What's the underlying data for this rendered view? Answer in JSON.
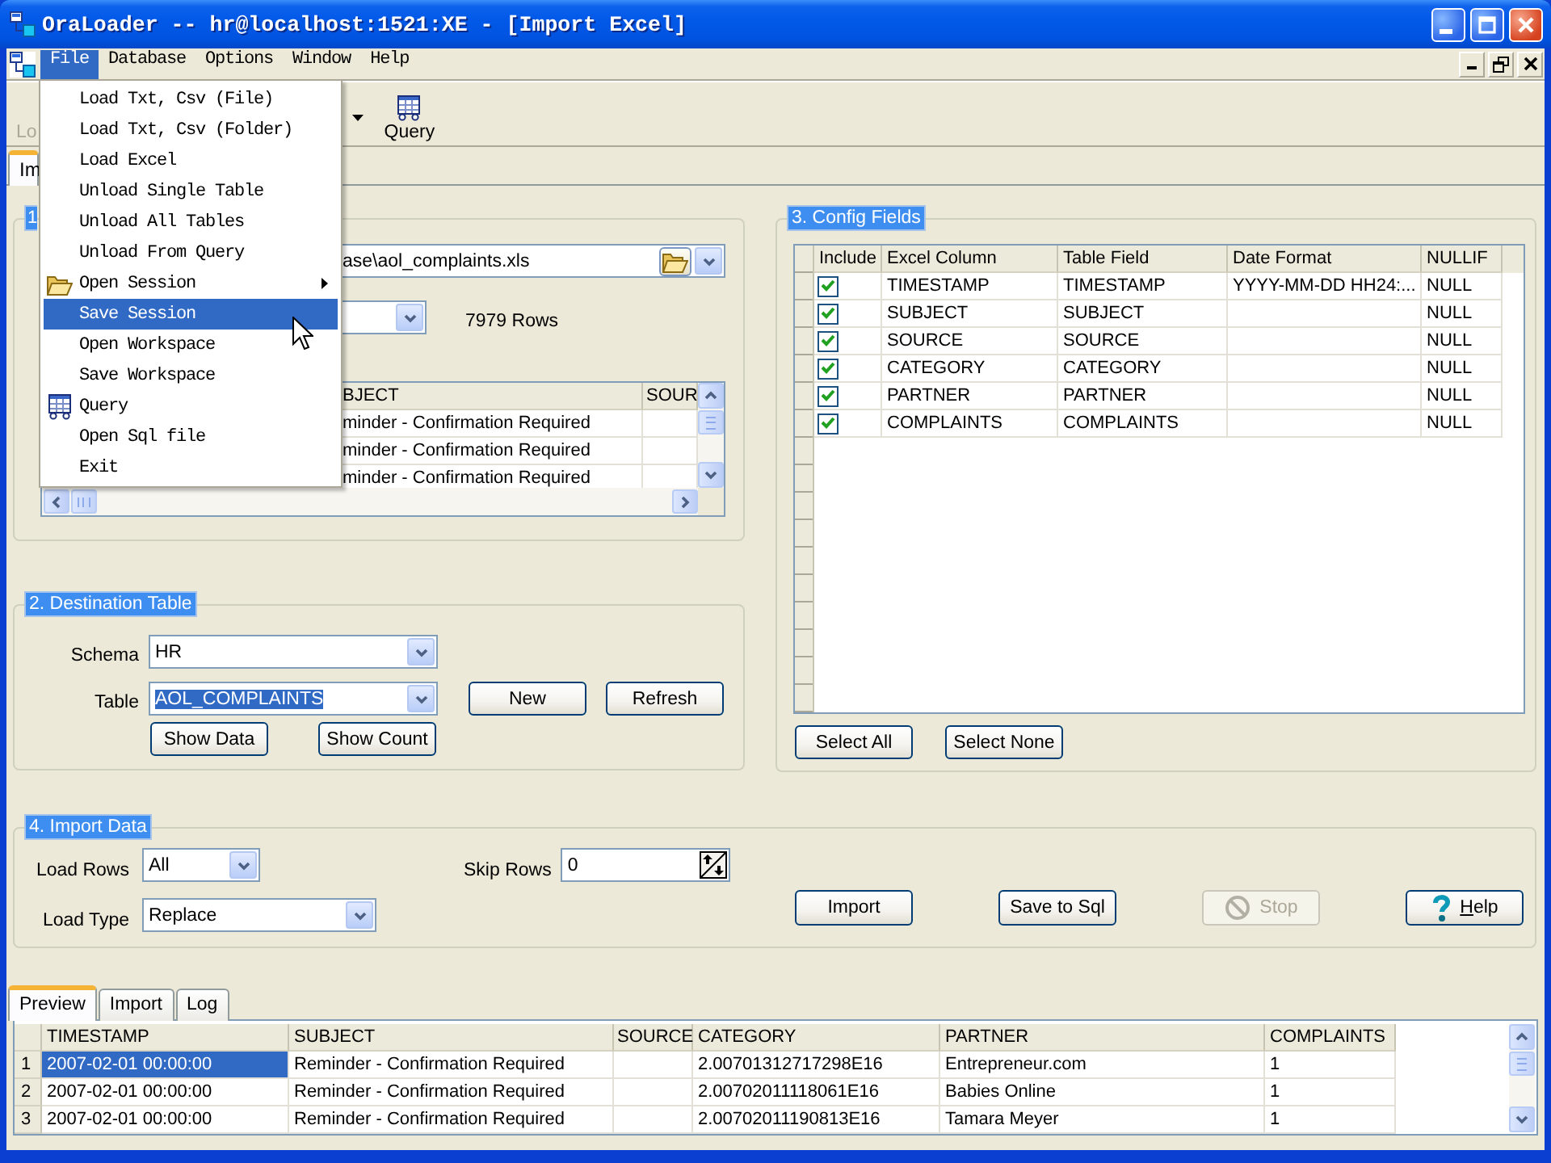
{
  "window": {
    "title": "OraLoader -- hr@localhost:1521:XE - [Import Excel]"
  },
  "menu_bar": {
    "items": [
      {
        "label": "File",
        "selected": true
      },
      {
        "label": "Database",
        "selected": false
      },
      {
        "label": "Options",
        "selected": false
      },
      {
        "label": "Window",
        "selected": false
      },
      {
        "label": "Help",
        "selected": false
      }
    ]
  },
  "file_menu": {
    "items": [
      {
        "label": "Load Txt, Csv (File)",
        "kind": "plain",
        "submenu": false,
        "selected": false
      },
      {
        "label": "Load Txt, Csv (Folder)",
        "kind": "plain",
        "submenu": false,
        "selected": false
      },
      {
        "label": "Load Excel",
        "kind": "plain",
        "submenu": false,
        "selected": false
      },
      {
        "label": "Unload Single Table",
        "kind": "plain",
        "submenu": false,
        "selected": false
      },
      {
        "label": "Unload All Tables",
        "kind": "plain",
        "submenu": false,
        "selected": false
      },
      {
        "label": "Unload From Query",
        "kind": "plain",
        "submenu": false,
        "selected": false
      },
      {
        "label": "Open Session",
        "kind": "folder",
        "submenu": true,
        "selected": false
      },
      {
        "label": "Save Session",
        "kind": "plain",
        "submenu": false,
        "selected": true
      },
      {
        "label": "Open Workspace",
        "kind": "plain",
        "submenu": false,
        "selected": false
      },
      {
        "label": "Save Workspace",
        "kind": "plain",
        "submenu": false,
        "selected": false
      },
      {
        "label": "Query",
        "kind": "query",
        "submenu": false,
        "selected": false
      },
      {
        "label": "Open Sql file",
        "kind": "plain",
        "submenu": false,
        "selected": false
      },
      {
        "label": "Exit",
        "kind": "plain",
        "submenu": false,
        "selected": false
      }
    ]
  },
  "toolbar": {
    "buttons": [
      {
        "label": "Lo",
        "kind": "plain",
        "disabled": true
      },
      {
        "label": "Query",
        "kind": "query",
        "disabled": false
      }
    ]
  },
  "document_tabs": [
    {
      "label": "Im",
      "selected": true
    }
  ],
  "source_group": {
    "title": "1",
    "file_path": "ase\\aol_complaints.xls",
    "row_count": "7979 Rows",
    "grid": {
      "columns": [
        "BJECT",
        "SOUR"
      ],
      "rows": [
        [
          "minder - Confirmation Required"
        ],
        [
          "minder - Confirmation Required"
        ],
        [
          "minder - Confirmation Required"
        ]
      ]
    }
  },
  "destination_group": {
    "title": "2. Destination Table",
    "schema": {
      "label": "Schema",
      "value": "HR"
    },
    "table": {
      "label": "Table",
      "value": "AOL_COMPLAINTS",
      "text_selected": true
    },
    "side_buttons": [
      "New",
      "Refresh"
    ],
    "data_buttons": [
      "Show Data",
      "Show Count"
    ]
  },
  "config_group": {
    "title": "3. Config Fields",
    "grid": {
      "columns": [
        "Include",
        "Excel Column",
        "Table Field",
        "Date Format",
        "NULLIF"
      ],
      "rows": [
        {
          "include": true,
          "excel_column": "TIMESTAMP",
          "table_field": "TIMESTAMP",
          "date_format": "YYYY-MM-DD HH24:...",
          "nullif": "NULL"
        },
        {
          "include": true,
          "excel_column": "SUBJECT",
          "table_field": "SUBJECT",
          "nullif": "NULL"
        },
        {
          "include": true,
          "excel_column": "SOURCE",
          "table_field": "SOURCE",
          "nullif": "NULL"
        },
        {
          "include": true,
          "excel_column": "CATEGORY",
          "table_field": "CATEGORY",
          "nullif": "NULL"
        },
        {
          "include": true,
          "excel_column": "PARTNER",
          "table_field": "PARTNER",
          "nullif": "NULL"
        },
        {
          "include": true,
          "excel_column": "COMPLAINTS",
          "table_field": "COMPLAINTS",
          "nullif": "NULL"
        }
      ]
    },
    "buttons": [
      "Select All",
      "Select None"
    ]
  },
  "import_group": {
    "title": "4. Import Data",
    "load_rows": {
      "label": "Load Rows",
      "value": "All"
    },
    "load_type": {
      "label": "Load Type",
      "value": "Replace"
    },
    "skip_rows": {
      "label": "Skip Rows",
      "value": "0"
    },
    "buttons": [
      {
        "label": "Import",
        "kind": "plain",
        "disabled": false,
        "access_key_underlined": false
      },
      {
        "label": "Save to Sql",
        "kind": "plain",
        "disabled": false,
        "access_key_underlined": false
      },
      {
        "label": "Stop",
        "kind": "stop",
        "disabled": true,
        "access_key_underlined": false
      },
      {
        "label": "Help",
        "kind": "help",
        "disabled": false,
        "access_key_underlined": true
      }
    ]
  },
  "result_tabs": [
    {
      "label": "Preview",
      "selected": true
    },
    {
      "label": "Import",
      "selected": false
    },
    {
      "label": "Log",
      "selected": false
    }
  ],
  "preview_grid": {
    "columns": [
      "TIMESTAMP",
      "SUBJECT",
      "SOURCE",
      "CATEGORY",
      "PARTNER",
      "COMPLAINTS"
    ],
    "rows": [
      {
        "number": "1",
        "cells": [
          {
            "text": "2007-02-01 00:00:00",
            "selected": true
          },
          {
            "text": "Reminder - Confirmation Required",
            "selected": false
          },
          {
            "selected": false
          },
          {
            "text": "2.00701312717298E16",
            "selected": false
          },
          {
            "text": "Entrepreneur.com",
            "selected": false
          },
          {
            "text": "1",
            "selected": false
          }
        ]
      },
      {
        "number": "2",
        "cells": [
          {
            "text": "2007-02-01 00:00:00",
            "selected": false
          },
          {
            "text": "Reminder - Confirmation Required",
            "selected": false
          },
          {
            "selected": false
          },
          {
            "text": "2.00702011118061E16",
            "selected": false
          },
          {
            "text": "Babies Online",
            "selected": false
          },
          {
            "text": "1",
            "selected": false
          }
        ]
      },
      {
        "number": "3",
        "cells": [
          {
            "text": "2007-02-01 00:00:00",
            "selected": false
          },
          {
            "text": "Reminder - Confirmation Required",
            "selected": false
          },
          {
            "selected": false
          },
          {
            "text": "2.00702011190813E16",
            "selected": false
          },
          {
            "text": "Tamara Meyer",
            "selected": false
          },
          {
            "text": "1",
            "selected": false
          }
        ]
      }
    ]
  }
}
